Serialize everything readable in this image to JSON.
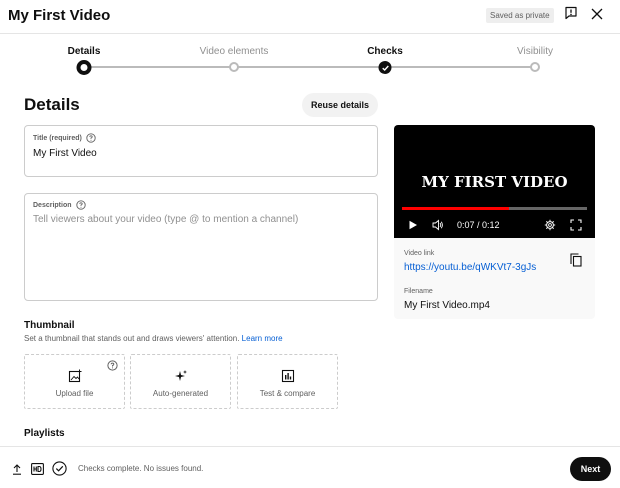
{
  "header": {
    "title": "My First Video",
    "saved_badge": "Saved as private",
    "feedback_icon": "feedback-icon",
    "close_icon": "close-icon"
  },
  "stepper": {
    "steps": [
      {
        "label": "Details",
        "state": "current"
      },
      {
        "label": "Video elements",
        "state": "pending"
      },
      {
        "label": "Checks",
        "state": "done"
      },
      {
        "label": "Visibility",
        "state": "pending"
      }
    ]
  },
  "details": {
    "heading": "Details",
    "reuse_button": "Reuse details",
    "title_field": {
      "label": "Title (required)",
      "value": "My First Video"
    },
    "description_field": {
      "label": "Description",
      "placeholder": "Tell viewers about your video (type @ to mention a channel)"
    }
  },
  "thumbnail": {
    "heading": "Thumbnail",
    "description": "Set a thumbnail that stands out and draws viewers' attention.",
    "learn_more": "Learn more",
    "options": [
      {
        "label": "Upload file",
        "icon": "image-upload-icon"
      },
      {
        "label": "Auto-generated",
        "icon": "sparkle-icon"
      },
      {
        "label": "Test & compare",
        "icon": "chart-icon"
      }
    ]
  },
  "playlists": {
    "heading": "Playlists"
  },
  "video": {
    "overlay_text": "MY FIRST VIDEO",
    "time": "0:07 / 0:12",
    "progress": 0.58,
    "link_label": "Video link",
    "link_value": "https://youtu.be/qWKVt7-3gJs",
    "filename_label": "Filename",
    "filename_value": "My First Video.mp4"
  },
  "footer": {
    "status": "Checks complete. No issues found.",
    "next_button": "Next"
  },
  "colors": {
    "accent": "#065fd4",
    "progress": "#ff0000",
    "dark": "#0f0f0f"
  }
}
